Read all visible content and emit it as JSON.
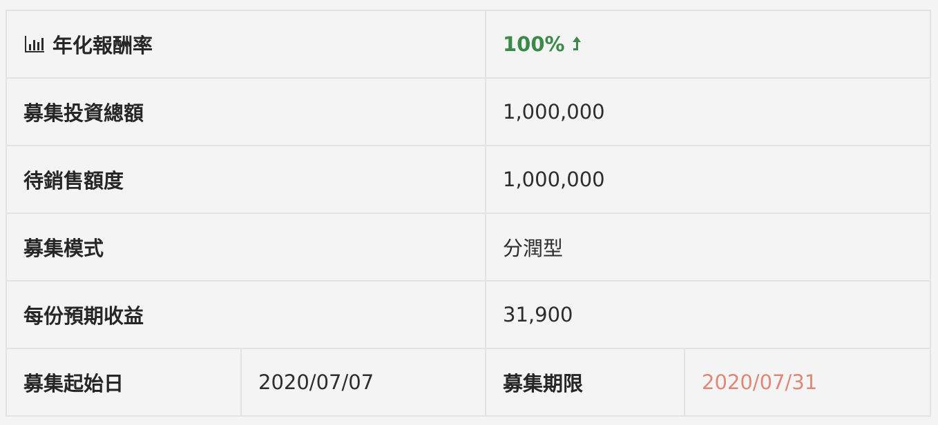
{
  "rows": {
    "rate": {
      "label": "年化報酬率",
      "value": "100%",
      "color": "#3c8a4a",
      "icons": [
        "bar-chart-icon",
        "arrow-up-icon"
      ]
    },
    "total": {
      "label": "募集投資總額",
      "value": "1,000,000"
    },
    "remaining": {
      "label": "待銷售額度",
      "value": "1,000,000"
    },
    "mode": {
      "label": "募集模式",
      "value": "分潤型"
    },
    "expected": {
      "label": "每份預期收益",
      "value": "31,900"
    },
    "dates": {
      "start_label": "募集起始日",
      "start_value": "2020/07/07",
      "end_label": "募集期限",
      "end_value": "2020/07/31",
      "end_color": "#e08878"
    }
  }
}
